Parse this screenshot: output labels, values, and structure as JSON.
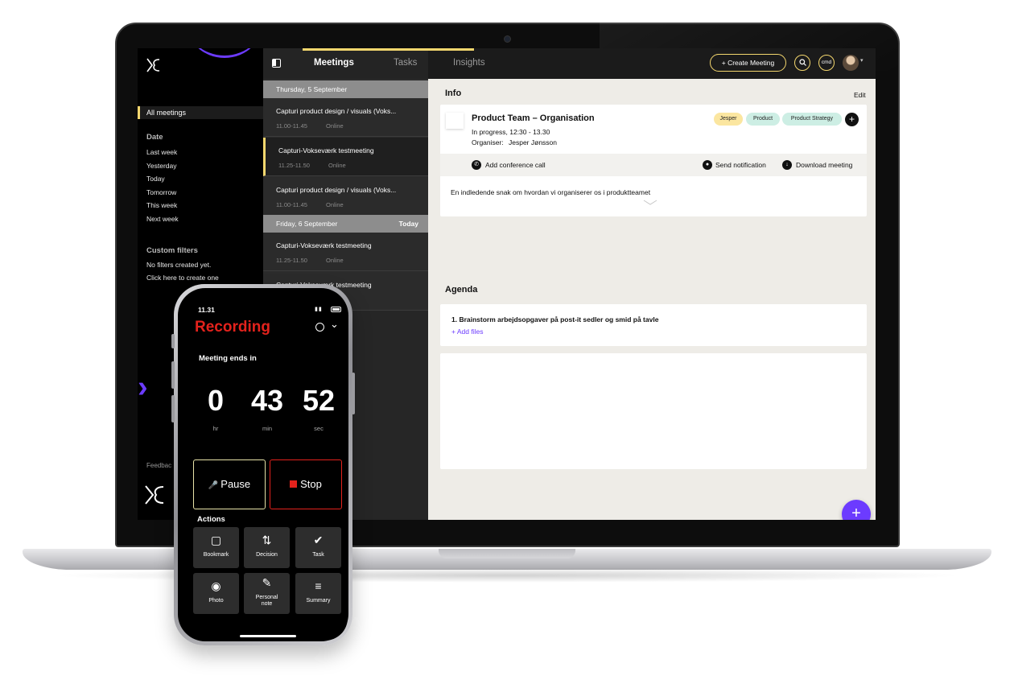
{
  "nav": {
    "active_item": "All meetings",
    "date_section": "Date",
    "date_filters": [
      "Last week",
      "Yesterday",
      "Today",
      "Tomorrow",
      "This week",
      "Next week"
    ],
    "custom_section": "Custom filters",
    "no_filters": "No filters created yet.",
    "create_filter": "Click here to create one",
    "feedback": "Feedbac"
  },
  "list": {
    "day1": "Thursday, 5 September",
    "day2": "Friday, 6 September",
    "day2_badge": "Today",
    "meetings": [
      {
        "title": "Capturi product design / visuals (Voks...",
        "time": "11.00-11.45",
        "location": "Online"
      },
      {
        "title": "Capturi-Vokseværk testmeeting",
        "time": "11.25-11.50",
        "location": "Online"
      },
      {
        "title": "Capturi product design / visuals (Voks...",
        "time": "11.00-11.45",
        "location": "Online"
      },
      {
        "title": "Capturi-Vokseværk testmeeting",
        "time": "11.25-11.50",
        "location": "Online"
      },
      {
        "title": "Capturi-Vokseværk testmeeting",
        "time": "",
        "location": ""
      }
    ]
  },
  "topbar": {
    "tabs": [
      "Meetings",
      "Tasks",
      "Insights"
    ],
    "create_label": "+ Create Meeting",
    "cmd_label": "cmd"
  },
  "info": {
    "section": "Info",
    "edit": "Edit",
    "title": "Product Team – Organisation",
    "status": "In progress, 12:30 - 13.30",
    "organiser_label": "Organiser:",
    "organiser_name": "Jesper Jønsson",
    "tags": [
      {
        "label": "Jesper",
        "color": "#fbe6a0"
      },
      {
        "label": "Product",
        "color": "#cdeee4"
      },
      {
        "label": "Product Strategy",
        "color": "#cdeee4"
      }
    ],
    "add_conference": "Add conference call",
    "send_notification": "Send notification",
    "download_meeting": "Download meeting",
    "description": "En indledende snak om hvordan vi organiserer os i produktteamet"
  },
  "agenda": {
    "section": "Agenda",
    "item": "1. Brainstorm arbejdsopgaver på post-it sedler og smid på tavle",
    "add_files": "+ Add files"
  },
  "phone": {
    "time": "11.31",
    "recording": "Recording",
    "ends_label": "Meeting ends in",
    "hours": "0",
    "minutes": "43",
    "seconds": "52",
    "hr": "hr",
    "min": "min",
    "sec": "sec",
    "pause": "Pause",
    "stop": "Stop",
    "actions_label": "Actions",
    "actions": [
      "Bookmark",
      "Decision",
      "Task",
      "Photo",
      "Personal note",
      "Summary"
    ]
  }
}
